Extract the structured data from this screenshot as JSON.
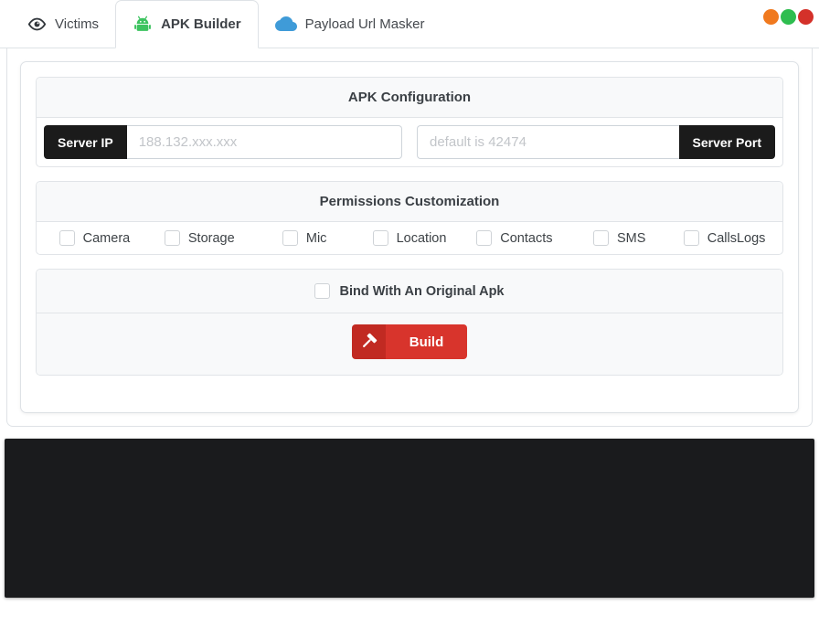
{
  "window": {
    "dots": [
      {
        "name": "orange",
        "color": "#f0791e"
      },
      {
        "name": "green",
        "color": "#2ebd4f"
      },
      {
        "name": "red",
        "color": "#d4312a"
      }
    ]
  },
  "tabs": [
    {
      "label": "Victims",
      "icon": "eye-icon",
      "active": false
    },
    {
      "label": "APK Builder",
      "icon": "android-icon",
      "active": true
    },
    {
      "label": "Payload Url Masker",
      "icon": "cloud-icon",
      "active": false
    }
  ],
  "apk_configuration": {
    "title": "APK Configuration",
    "server_ip": {
      "label": "Server IP",
      "placeholder": "188.132.xxx.xxx",
      "value": ""
    },
    "server_port": {
      "label": "Server Port",
      "placeholder": "default is 42474",
      "value": ""
    }
  },
  "permissions": {
    "title": "Permissions Customization",
    "items": [
      {
        "label": "Camera",
        "checked": false
      },
      {
        "label": "Storage",
        "checked": false
      },
      {
        "label": "Mic",
        "checked": false
      },
      {
        "label": "Location",
        "checked": false
      },
      {
        "label": "Contacts",
        "checked": false
      },
      {
        "label": "SMS",
        "checked": false
      },
      {
        "label": "CallsLogs",
        "checked": false
      }
    ]
  },
  "bind": {
    "label": "Bind With An Original Apk",
    "checked": false
  },
  "build": {
    "label": "Build",
    "icon": "hammer-icon"
  },
  "console": {
    "content": ""
  },
  "colors": {
    "tab_border": "#dee2e6",
    "card_border": "#e1e4e8",
    "card_header_bg": "#f8f9fa",
    "label_bg": "#1b1b1b",
    "build_red": "#d8342c",
    "build_red_dark": "#c12a22",
    "android_green": "#3cc35f",
    "cloud_blue": "#3f9bd8",
    "console_bg": "#1a1b1d"
  }
}
